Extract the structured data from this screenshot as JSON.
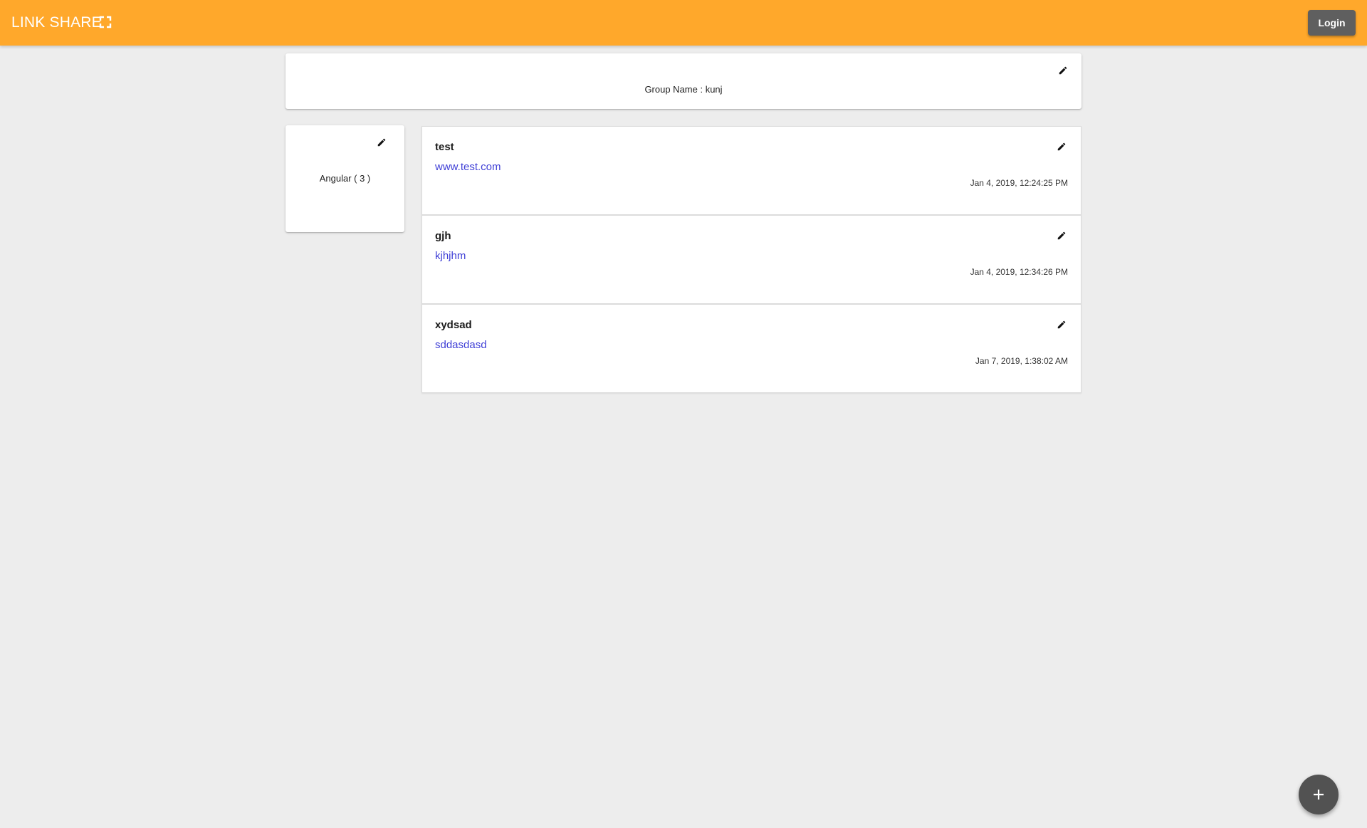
{
  "app": {
    "title": "LINK SHARE",
    "accent_color": "#ffa82b"
  },
  "toolbar": {
    "fullscreen_icon": "fullscreen-icon",
    "login_label": "Login"
  },
  "group": {
    "label": "Group Name : kunj",
    "edit_icon": "pencil-icon"
  },
  "category": {
    "label": "Angular ( 3 )",
    "edit_icon": "pencil-icon"
  },
  "links": [
    {
      "title": "test",
      "url": "www.test.com",
      "date": "Jan 4, 2019, 12:24:25 PM"
    },
    {
      "title": "gjh",
      "url": "kjhjhm",
      "date": "Jan 4, 2019, 12:34:26 PM"
    },
    {
      "title": "xydsad",
      "url": "sddasdasd",
      "date": "Jan 7, 2019, 1:38:02 AM"
    }
  ],
  "fab": {
    "icon": "plus-icon"
  }
}
